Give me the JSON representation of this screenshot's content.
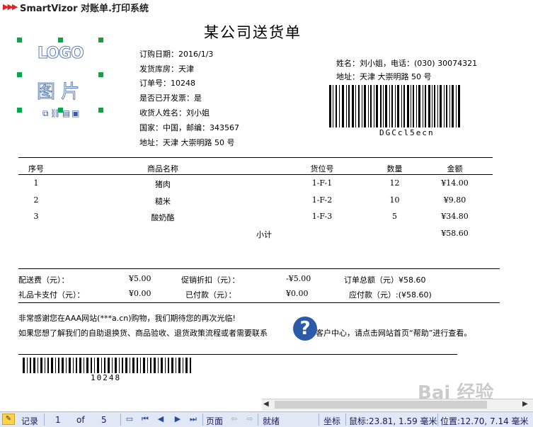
{
  "app": {
    "title": "SmartVizor 对账单.打印系统"
  },
  "report": {
    "title": "某公司送货单",
    "logo": {
      "text": "LOGO",
      "picture": "图 片"
    },
    "order": {
      "date": "订购日期：2016/1/3",
      "warehouse": "发货库房：天津",
      "order_no": "订单号：10248",
      "invoice": "是否已开发票：是",
      "recipient": "收货人姓名：刘小姐",
      "country": "国家：中国，邮编：343567",
      "address": "地址：天津 大崇明路 50 号"
    },
    "contact": {
      "name_phone": "姓名：刘小姐，电话：(030) 30074321",
      "address": "地址：天津 大崇明路 50 号"
    },
    "barcode_text": "DGCcl5ecn",
    "table": {
      "headers": [
        "序号",
        "商品名称",
        "货位号",
        "数量",
        "金额"
      ],
      "rows": [
        [
          "1",
          "猪肉",
          "1-F-1",
          "12",
          "¥14.00"
        ],
        [
          "2",
          "糙米",
          "1-F-2",
          "10",
          "¥9.80"
        ],
        [
          "3",
          "酸奶酪",
          "1-F-3",
          "5",
          "¥34.80"
        ]
      ],
      "subtotal_label": "小计",
      "subtotal_value": "¥58.60"
    },
    "summary": {
      "shipping_label": "配送费（元）：",
      "shipping_value": "¥5.00",
      "discount_label": "促销折扣（元）：",
      "discount_value": "-¥5.00",
      "total_label": "订单总额（元）¥58.60",
      "giftcard_label": "礼品卡支付（元）：",
      "giftcard_value": "¥0.00",
      "paid_label": "已付款（元）：",
      "paid_value": "¥0.00",
      "due_label": "应付款（元）:(¥58.60)"
    },
    "notes": {
      "line1": "非常感谢您在AAA网站(***a.cn)购物，我们期待您的再次光临!",
      "line2": "如果您想了解我们的自助退换货、商品验收、退货政策流程或者需要联系",
      "line2b": "客户中心，请点击网站首页“帮助”进行查看。"
    },
    "bottom_barcode_text": "10248"
  },
  "statusbar": {
    "records_label": "记录",
    "current": "1",
    "of_label": "of",
    "total": "5",
    "page_label": "页面",
    "status": "就绪",
    "coords_label": "坐标",
    "mouse": "鼠标:23.81, 1.59 毫米",
    "position": "位置:12.70, 7.14 毫米"
  },
  "watermark": "Bai 经验",
  "colors": {
    "statusbar_bg": "#dfe8f4",
    "help_icon": "#2a5aa8",
    "handle": "#1e9e3a"
  }
}
